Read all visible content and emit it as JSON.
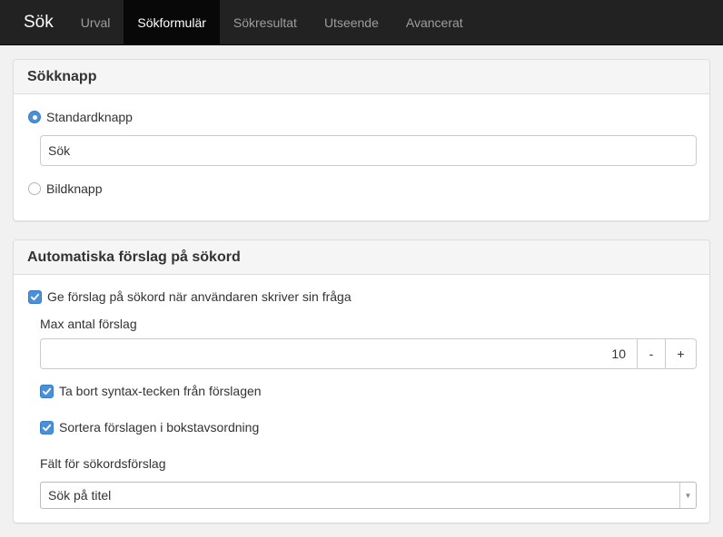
{
  "nav": {
    "brand": "Sök",
    "tabs": [
      {
        "label": "Urval"
      },
      {
        "label": "Sökformulär",
        "active": true
      },
      {
        "label": "Sökresultat"
      },
      {
        "label": "Utseende"
      },
      {
        "label": "Avancerat"
      }
    ]
  },
  "search_button_panel": {
    "title": "Sökknapp",
    "standard_option": {
      "label": "Standardknapp",
      "checked": true
    },
    "standard_text_value": "Sök",
    "image_option": {
      "label": "Bildknapp",
      "checked": false
    }
  },
  "suggestions_panel": {
    "title": "Automatiska förslag på sökord",
    "enable_checkbox": {
      "label": "Ge förslag på sökord när användaren skriver sin fråga",
      "checked": true
    },
    "max_label": "Max antal förslag",
    "max_value": "10",
    "decrement_label": "-",
    "increment_label": "+",
    "strip_syntax_checkbox": {
      "label": "Ta bort syntax-tecken från förslagen",
      "checked": true
    },
    "sort_checkbox": {
      "label": "Sortera förslagen i bokstavsordning",
      "checked": true
    },
    "field_label": "Fält för sökordsförslag",
    "field_select_value": "Sök på titel"
  },
  "colors": {
    "navbar_bg": "#222222",
    "active_tab_bg": "#080808",
    "accent": "#4a90d9"
  }
}
